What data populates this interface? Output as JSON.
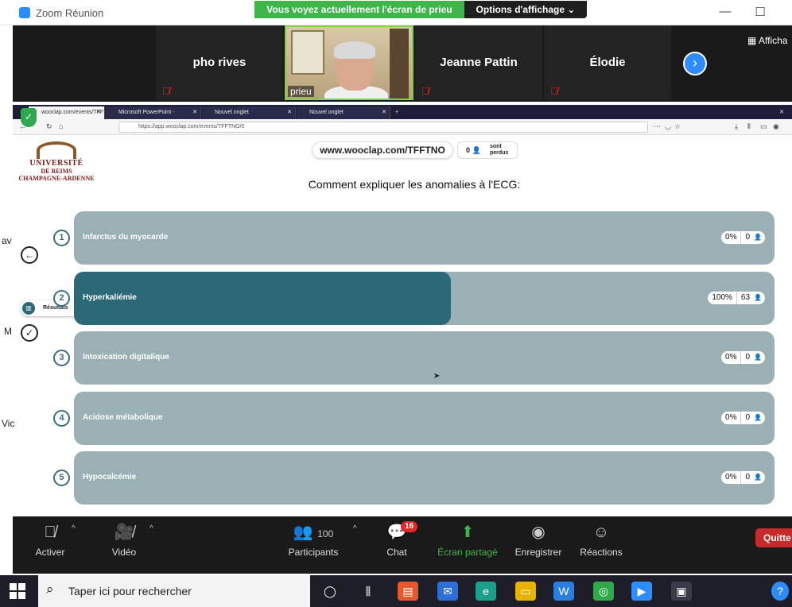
{
  "zoom": {
    "title": "Zoom Réunion",
    "share_banner": "Vous voyez actuellement l'écran de prieu",
    "view_options": "Options d'affichage ⌄",
    "gallery_label": "Afficha",
    "participants": [
      {
        "name": "pho rives"
      },
      {
        "name": "prieu"
      },
      {
        "name": "Jeanne Pattin"
      },
      {
        "name": "Élodie"
      }
    ],
    "controls": {
      "mute": "Activer",
      "video": "Vidéo",
      "participants": "Participants",
      "participants_count": "100",
      "chat": "Chat",
      "chat_badge": "16",
      "share": "Écran partagé",
      "record": "Enregistrer",
      "reactions": "Réactions",
      "quit": "Quitte"
    }
  },
  "browser": {
    "tabs": [
      {
        "label": "wooclap.com/events/TFFTNO"
      },
      {
        "label": "Microsoft PowerPoint - godin_ribo"
      },
      {
        "label": "Nouvel onglet"
      },
      {
        "label": "Nouvel onglet"
      }
    ],
    "url": "https://app.wooclap.com/events/TFFTNO/0"
  },
  "wooclap": {
    "logo_line1": "UNIVERSITÉ",
    "logo_line2": "DE REIMS",
    "logo_line3": "CHAMPAGNE-ARDENNE",
    "join_url": "www.wooclap.com/TFFTNO",
    "lost_count": "0",
    "lost_label1": "sont",
    "lost_label2": "perdus",
    "question": "Comment expliquer les anomalies à l'ECG:",
    "results_label": "Résultats",
    "answers": [
      {
        "num": "1",
        "text": "Infarctus du myocarde",
        "pct": "0%",
        "votes": "0",
        "fill": 0
      },
      {
        "num": "2",
        "text": "Hyperkaliémie",
        "pct": "100%",
        "votes": "63",
        "fill": 0.538
      },
      {
        "num": "3",
        "text": "Intoxication digitalique",
        "pct": "0%",
        "votes": "0",
        "fill": 0
      },
      {
        "num": "4",
        "text": "Acidose métabolique",
        "pct": "0%",
        "votes": "0",
        "fill": 0
      },
      {
        "num": "5",
        "text": "Hypocalcémie",
        "pct": "0%",
        "votes": "0",
        "fill": 0
      }
    ],
    "side_fragments": [
      "av",
      "M",
      "Vic"
    ]
  },
  "taskbar": {
    "search_placeholder": "Taper ici pour rechercher"
  },
  "colors": {
    "zoom_green": "#3fb64a",
    "wooclap_bar": "#9ab0b5",
    "wooclap_fill": "#2b6878",
    "quit_red": "#c72a2a"
  }
}
